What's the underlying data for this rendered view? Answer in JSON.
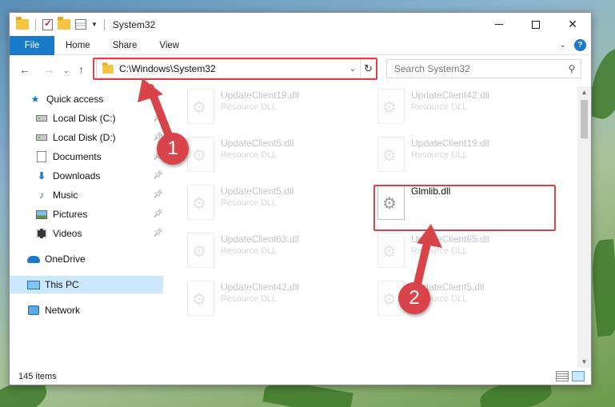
{
  "window": {
    "title": "System32",
    "controls": [
      "minimize",
      "maximize",
      "close"
    ]
  },
  "ribbon": {
    "tabs": [
      "File",
      "Home",
      "Share",
      "View"
    ],
    "help_label": "?"
  },
  "nav": {
    "address": "C:\\Windows\\System32",
    "search_placeholder": "Search System32"
  },
  "sidebar": {
    "quick_access": "Quick access",
    "items": [
      {
        "label": "Local Disk (C:)",
        "icon": "drive-icon",
        "pinned": true
      },
      {
        "label": "Local Disk (D:)",
        "icon": "drive-icon",
        "pinned": true
      },
      {
        "label": "Documents",
        "icon": "documents-icon",
        "pinned": true
      },
      {
        "label": "Downloads",
        "icon": "downloads-icon",
        "pinned": true
      },
      {
        "label": "Music",
        "icon": "music-icon",
        "pinned": true
      },
      {
        "label": "Pictures",
        "icon": "pictures-icon",
        "pinned": true
      },
      {
        "label": "Videos",
        "icon": "videos-icon",
        "pinned": true
      }
    ],
    "onedrive": "OneDrive",
    "this_pc": "This PC",
    "network": "Network"
  },
  "files": [
    {
      "name": "UpdateClient19.dll",
      "type": "Resource DLL",
      "faded": true
    },
    {
      "name": "UpdateClient42.dll",
      "type": "Resource DLL",
      "faded": true
    },
    {
      "name": "UpdateClient5.dll",
      "type": "Resource DLL",
      "faded": true
    },
    {
      "name": "UpdateClient19.dll",
      "type": "Resource DLL",
      "faded": true
    },
    {
      "name": "UpdateClient5.dll",
      "type": "Resource DLL",
      "faded": true
    },
    {
      "name": "Glmlib.dll",
      "type": "",
      "faded": false
    },
    {
      "name": "UpdateClient63.dll",
      "type": "Resource DLL",
      "faded": true
    },
    {
      "name": "UpdateClient65.dll",
      "type": "Resource DLL",
      "faded": true
    },
    {
      "name": "UpdateClient42.dll",
      "type": "Resource DLL",
      "faded": true
    },
    {
      "name": "UpdateClient5.dll",
      "type": "Resource DLL",
      "faded": true
    }
  ],
  "status": {
    "item_count": "145 items"
  },
  "annotations": {
    "callout_1": "1",
    "callout_2": "2",
    "color": "#d9444a"
  }
}
